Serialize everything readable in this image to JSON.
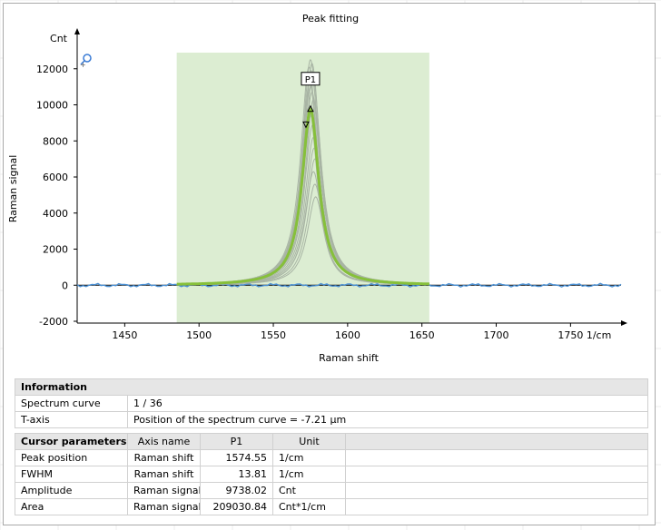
{
  "chart_data": {
    "type": "line",
    "title": "Peak fitting",
    "xlabel": "Raman shift",
    "ylabel": "Raman signal",
    "y_unit": "Cnt",
    "x_unit": "1/cm",
    "xlim": [
      1418,
      1784
    ],
    "ylim": [
      -2100,
      13800
    ],
    "x_ticks": [
      1450,
      1500,
      1550,
      1600,
      1650,
      1700,
      1750
    ],
    "x_tick_labels": [
      "1450",
      "1500",
      "1550",
      "1600",
      "1650",
      "1700",
      "1750 1/cm"
    ],
    "y_ticks": [
      -2000,
      0,
      2000,
      4000,
      6000,
      8000,
      10000,
      12000
    ],
    "y_tick_labels": [
      "-2000",
      "0",
      "2000",
      "4000",
      "6000",
      "8000",
      "10000",
      "12000"
    ],
    "fit_region": [
      1485,
      1655
    ],
    "peak": {
      "label": "P1",
      "center": 1575,
      "fwhm": 13.81,
      "fit_amplitude": 9738.02,
      "curve_amplitudes": [
        12500,
        12300,
        12100,
        11900,
        11600,
        11300,
        11000,
        10700,
        10300,
        9900,
        9400,
        8900,
        8200,
        7600,
        7000,
        6300,
        5600,
        4900
      ],
      "curve_offsets": [
        0,
        1,
        -1,
        0.5,
        1.5,
        -0.5,
        0,
        1,
        2,
        -1,
        0.5,
        1.5,
        2,
        2.5,
        3,
        2,
        3,
        3.5
      ],
      "marker_up_y": 9738,
      "marker_down_y": 8900
    },
    "colors": {
      "region": "#dcedd2",
      "curves": "#a8b4a4",
      "fit": "#86c03a",
      "baseline": "#4a90d4",
      "zero_line": "#000000"
    }
  },
  "table_info": {
    "header": "Information",
    "rows": [
      {
        "label": "Spectrum curve",
        "value": "1 / 36"
      },
      {
        "label": "T-axis",
        "value": "Position of the spectrum curve = -7.21 µm"
      }
    ]
  },
  "table_cursor": {
    "header": "Cursor parameters",
    "col_axis": "Axis name",
    "col_p1": "P1",
    "col_unit": "Unit",
    "rows": [
      {
        "label": "Peak position",
        "axis": "Raman shift",
        "value": "1574.55",
        "unit": "1/cm"
      },
      {
        "label": "FWHM",
        "axis": "Raman shift",
        "value": "13.81",
        "unit": "1/cm"
      },
      {
        "label": "Amplitude",
        "axis": "Raman signal",
        "value": "9738.02",
        "unit": "Cnt"
      },
      {
        "label": "Area",
        "axis": "Raman signal",
        "value": "209030.84",
        "unit": "Cnt*1/cm"
      }
    ]
  }
}
